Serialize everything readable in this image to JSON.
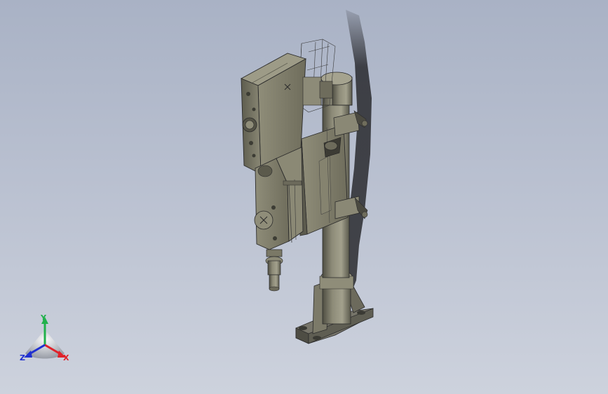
{
  "viewport": {
    "background_top": "#a9b2c5",
    "background_bottom": "#cdd2dd"
  },
  "model": {
    "body_color": "#7d7b68",
    "shadow_color": "#1f1f22"
  },
  "triad": {
    "x_label": "X",
    "y_label": "Y",
    "z_label": "Z",
    "x_color": "#e0222a",
    "y_color": "#22b14c",
    "z_color": "#2030d0"
  }
}
